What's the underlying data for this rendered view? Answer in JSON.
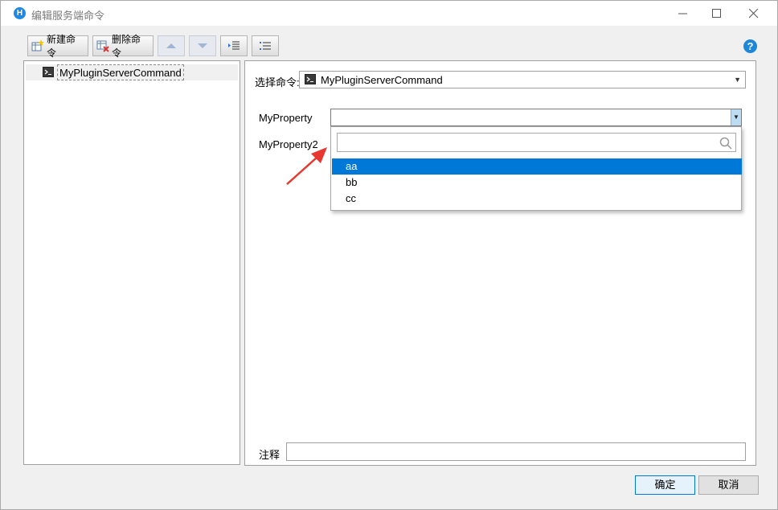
{
  "window": {
    "title": "编辑服务端命令",
    "app_icon_text": "H",
    "controls": [
      "minimize-icon",
      "maximize-icon",
      "close-icon"
    ]
  },
  "toolbar": {
    "new_label": "新建命令",
    "delete_label": "删除命令",
    "help_text": "?"
  },
  "tree": {
    "items": [
      {
        "label": "MyPluginServerCommand",
        "icon": "terminal-icon"
      }
    ]
  },
  "form": {
    "select_command_label": "选择命令:",
    "select_command_value": "MyPluginServerCommand",
    "property1_label": "MyProperty",
    "property1_value": "",
    "property2_label": "MyProperty2",
    "dropdown": {
      "search_placeholder": "",
      "options": [
        "aa",
        "bb",
        "cc"
      ],
      "highlighted": "aa"
    },
    "note_label": "注释",
    "note_value": ""
  },
  "footer": {
    "ok_label": "确定",
    "cancel_label": "取消"
  },
  "colors": {
    "selection": "#0078d7",
    "annotation_arrow": "#e8372f",
    "help": "#1c86d9"
  }
}
